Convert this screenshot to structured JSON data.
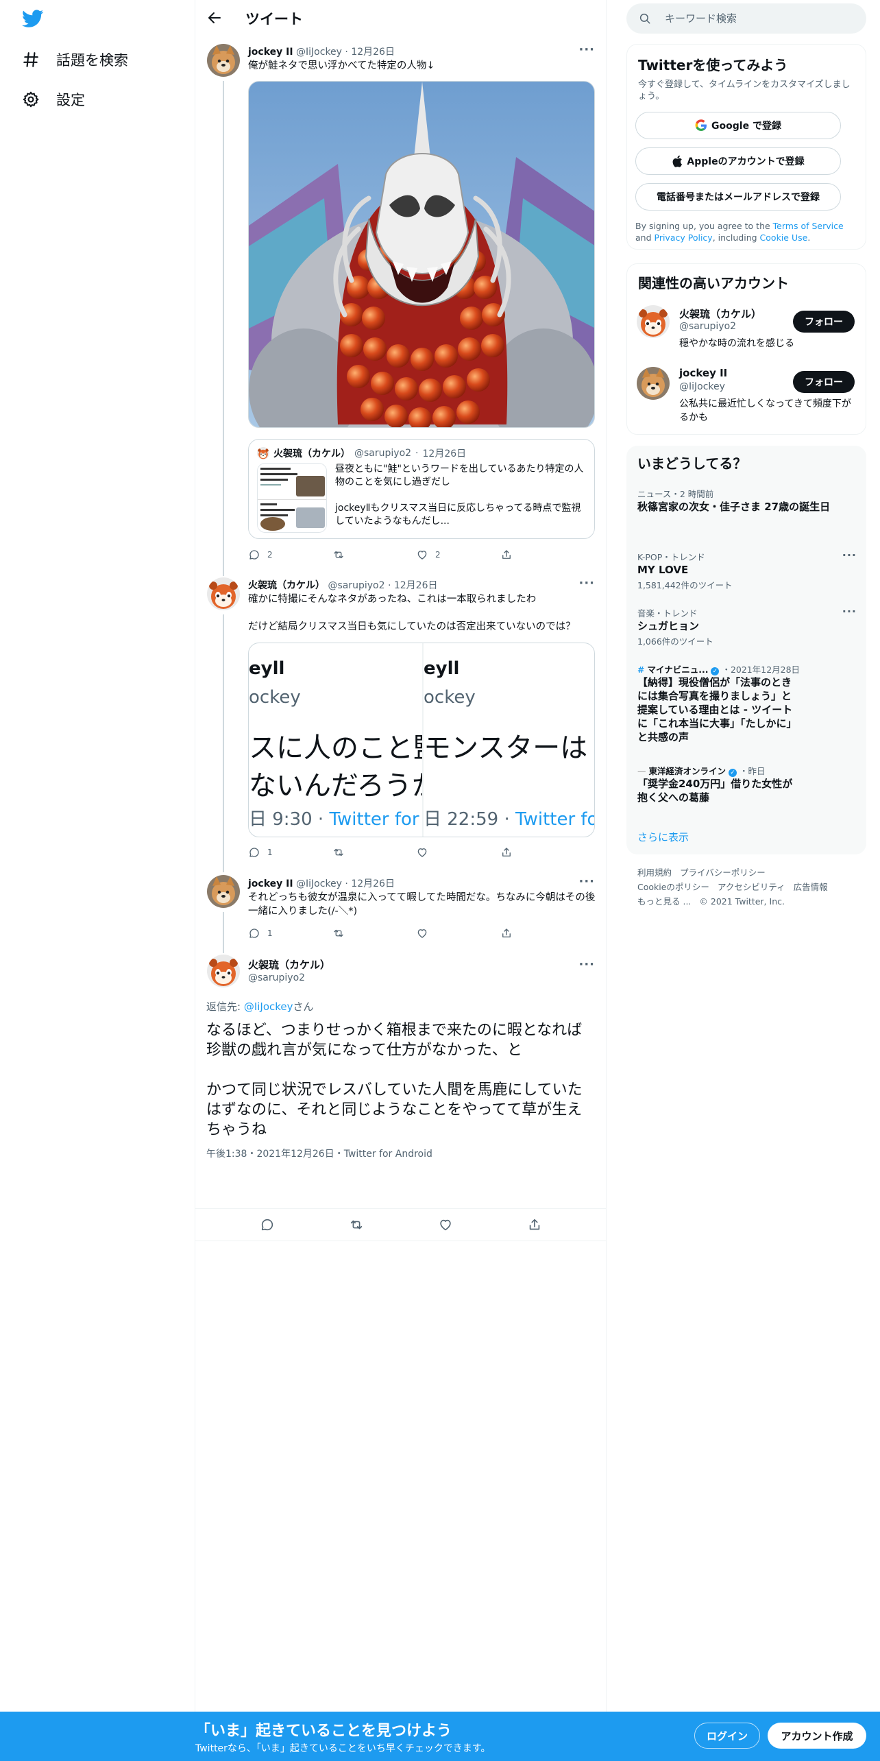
{
  "nav": {
    "explore_label": "話題を検索",
    "settings_label": "設定"
  },
  "header": {
    "title": "ツイート"
  },
  "tweets": [
    {
      "name": "jockey II",
      "handle": "@IiJockey",
      "date": "12月26日",
      "text": "俺が鮭ネタで思い浮かべてた特定の人物↓",
      "quote": {
        "name": "火袈琉（カケル）",
        "handle": "@sarupiyo2",
        "date": "12月26日",
        "text1": "昼夜ともに\"鮭\"というワードを出しているあたり特定の人物のことを気にし過ぎだし",
        "text2": "jockeyⅡもクリスマス当日に反応しちゃってる時点で監視していたようなもんだし..."
      },
      "replies": "2",
      "retweets": "",
      "likes": "2"
    },
    {
      "name": "火袈琉（カケル）",
      "handle": "@sarupiyo2",
      "date": "12月26日",
      "text1": "確かに特撮にそんなネタがあったね、これは一本取られましたわ",
      "text2": "だけど結局クリスマス当日も気にしていたのは否定出来ていないのでは？",
      "replies": "1",
      "retweets": "",
      "likes": ""
    },
    {
      "name": "jockey II",
      "handle": "@IiJockey",
      "date": "12月26日",
      "text": "それどっちも彼女が温泉に入ってて暇してた時間だな。ちなみに今朝はその後一緒に入りました(/-＼*)",
      "replies": "1",
      "retweets": "",
      "likes": ""
    }
  ],
  "screenshot_image": {
    "left": {
      "name": "eyll",
      "handle": "ockey",
      "line1": "スに人のこと監",
      "line2": "ないんだろうかっ...",
      "time": "日 9:30 · ",
      "client": "Twitter for A"
    },
    "right": {
      "name": "eyll",
      "handle": "ockey",
      "line1": "モンスターは",
      "line2": "",
      "time": "日 22:59 · ",
      "client": "Twitter for"
    }
  },
  "focus": {
    "name": "火袈琉（カケル）",
    "handle": "@sarupiyo2",
    "replying_prefix": "返信先: ",
    "replying_handle": "@IiJockey",
    "replying_suffix": "さん",
    "text1": "なるほど、つまりせっかく箱根まで来たのに暇となれば珍獣の戯れ言が気になって仕方がなかった、と",
    "text2": "かつて同じ状況でレスバしていた人間を馬鹿にしていたはずなのに、それと同じようなことをやってて草が生えちゃうね",
    "meta": "午後1:38・2021年12月26日・Twitter for Android"
  },
  "search": {
    "placeholder": "キーワード検索"
  },
  "signup": {
    "title": "Twitterを使ってみよう",
    "subtitle": "今すぐ登録して、タイムラインをカスタマイズしましょう。",
    "google": "Google で登録",
    "apple": "Appleのアカウントで登録",
    "phone": "電話番号またはメールアドレスで登録",
    "terms_prefix": "By signing up, you agree to the ",
    "terms_link": "Terms of Service",
    "terms_and": " and ",
    "privacy_link": "Privacy Policy",
    "terms_including": ", including ",
    "cookie_link": "Cookie Use",
    "terms_end": "."
  },
  "related": {
    "title": "関連性の高いアカウント",
    "accounts": [
      {
        "name": "火袈琉（カケル）",
        "handle": "@sarupiyo2",
        "bio": "穏やかな時の流れを感じる",
        "button": "フォロー"
      },
      {
        "name": "jockey II",
        "handle": "@IiJockey",
        "bio": "公私共に最近忙しくなってきて頻度下がるかも",
        "button": "フォロー"
      }
    ]
  },
  "trends": {
    "title": "いまどうしてる？",
    "items": [
      {
        "context": "ニュース・2 時間前",
        "title": "秋篠宮家の次女・佳子さま 27歳の誕生日",
        "count": ""
      },
      {
        "context": "K-POP・トレンド",
        "title": "MY LOVE",
        "count": "1,581,442件のツイート"
      },
      {
        "context": "音楽・トレンド",
        "title": "シュガヒョン",
        "count": "1,066件のツイート"
      },
      {
        "context": "マイナビニュ...",
        "context_date": "・2021年12月28日",
        "title": "【納得】現役僧侶が「法事のときには集合写真を撮りましょう」と提案している理由とは - ツイートに「これ本当に大事」「たしかに」と共感の声",
        "count": ""
      },
      {
        "context": "東洋経済オンライン",
        "context_date": "・昨日",
        "title": "「奨学金240万円」借りた女性が抱く父への葛藤",
        "count": ""
      }
    ],
    "show_more": "さらに表示"
  },
  "footer": {
    "links": [
      "利用規約",
      "プライバシーポリシー",
      "Cookieのポリシー",
      "アクセシビリティ",
      "広告情報",
      "もっと見る ..."
    ],
    "copyright": "© 2021 Twitter, Inc."
  },
  "bottom_bar": {
    "title": "「いま」起きていることを見つけよう",
    "subtitle": "Twitterなら、「いま」起きていることをいち早くチェックできます。",
    "login": "ログイン",
    "signup": "アカウント作成"
  },
  "colors": {
    "accent": "#1d9bf0",
    "text": "#0f1419",
    "secondary": "#536471",
    "border": "#eff3f4"
  }
}
